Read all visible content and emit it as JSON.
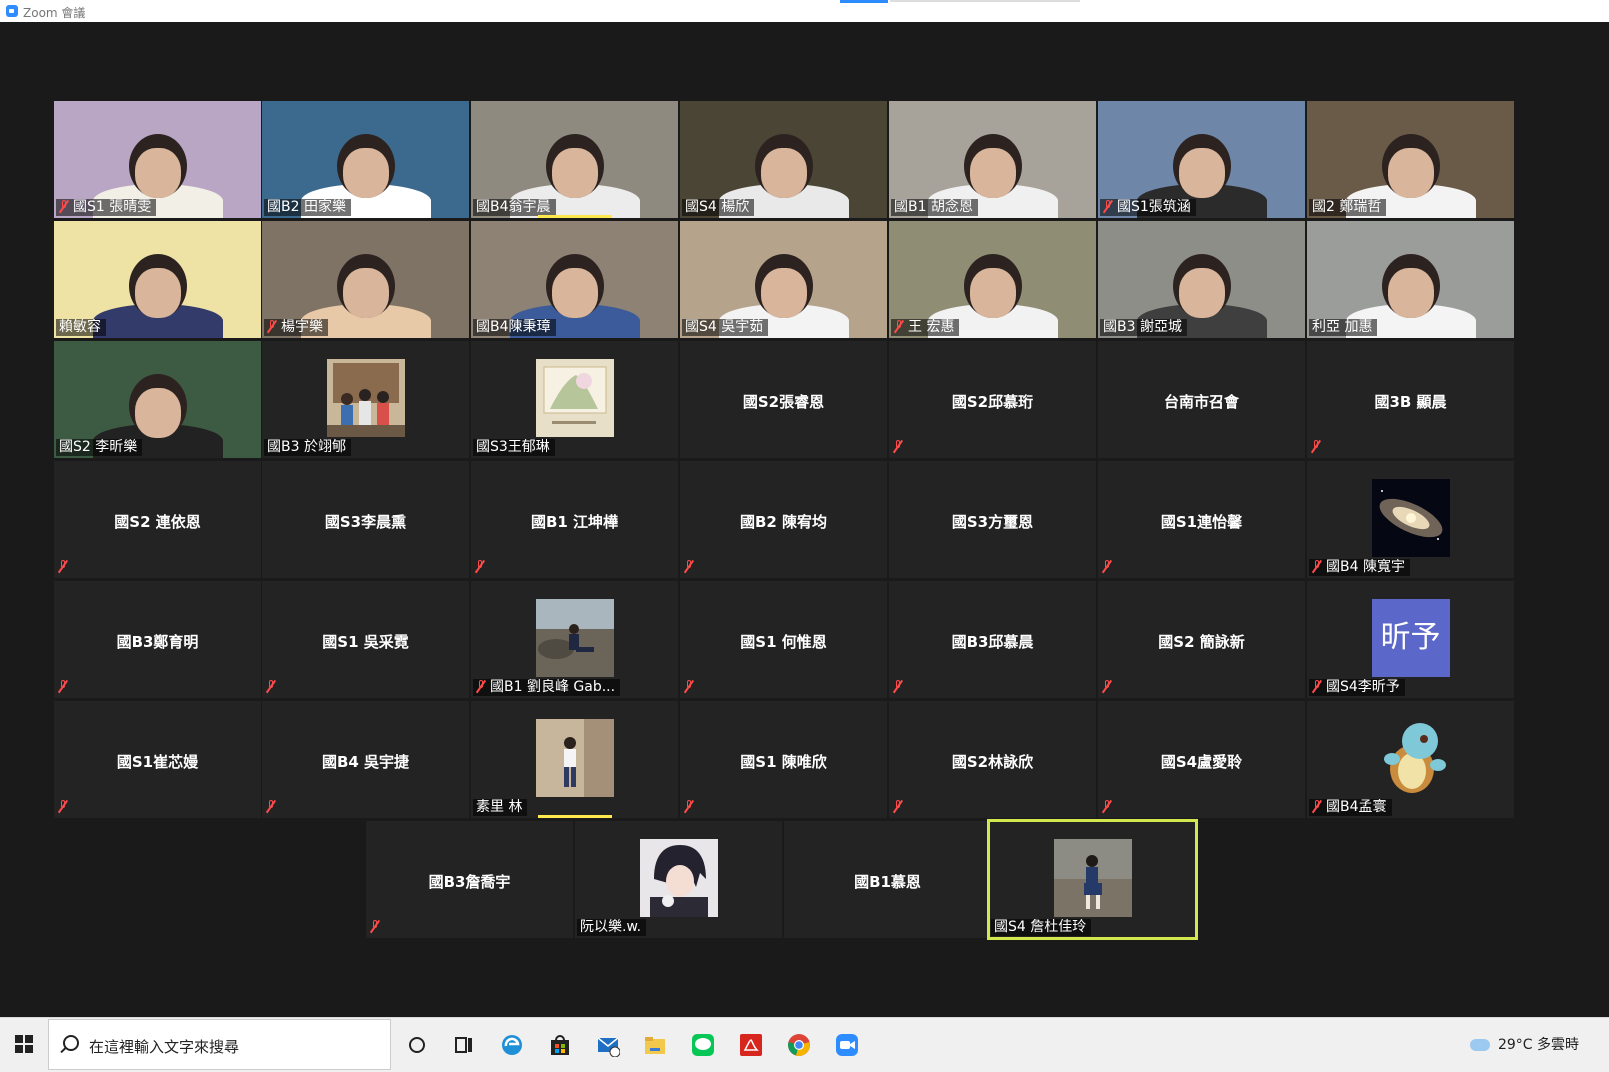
{
  "window": {
    "title": "Zoom 會議"
  },
  "video_tiles": [
    {
      "name": "國S1 張晴雯",
      "muted": true,
      "bg": "#b9a6c4",
      "shirt": "#f2efe6"
    },
    {
      "name": "國B2 田家樂",
      "muted": false,
      "bg": "#3c6a8e",
      "shirt": "#ffffff"
    },
    {
      "name": "國B4翁宇晨",
      "muted": false,
      "bg": "#8f8a7f",
      "shirt": "#ececec"
    },
    {
      "name": "國S4 楊欣",
      "muted": false,
      "bg": "#4a4534",
      "shirt": "#e9e9e9"
    },
    {
      "name": "國B1 胡念恩",
      "muted": false,
      "bg": "#a7a39a",
      "shirt": "#f0f0f0"
    },
    {
      "name": "國S1張筑涵",
      "muted": true,
      "bg": "#6e86a8",
      "shirt": "#2b2b2b"
    },
    {
      "name": "國2 鄭瑞哲",
      "muted": false,
      "bg": "#6a5a48",
      "shirt": "#f3f3f3"
    },
    {
      "name": "賴敏容",
      "muted": false,
      "bg": "#efe2a5",
      "shirt": "#333b6b"
    },
    {
      "name": "楊宇樂",
      "muted": true,
      "bg": "#7f7366",
      "shirt": "#e7c9a7"
    },
    {
      "name": "國B4陳秉璋",
      "muted": false,
      "bg": "#8d8273",
      "shirt": "#3b5b9a"
    },
    {
      "name": "國S4 吳宇茹",
      "muted": false,
      "bg": "#b6a38b",
      "shirt": "#f3f3f3"
    },
    {
      "name": "王 宏惠",
      "muted": true,
      "bg": "#8f8e75",
      "shirt": "#f2f2f2"
    },
    {
      "name": "國B3 謝亞城",
      "muted": false,
      "bg": "#8d8e88",
      "shirt": "#3f3f3f"
    },
    {
      "name": "利亞 加惠",
      "muted": false,
      "bg": "#9b9d9b",
      "shirt": "#f4f4f4"
    },
    {
      "name": "國S2 李昕樂",
      "muted": false,
      "bg": "#3d5a43",
      "shirt": "#222222"
    }
  ],
  "avatar_tiles": [
    {
      "name": "國B3 於翊郇",
      "muted": false,
      "art": "family-photo"
    },
    {
      "name": "國S3王郁琳",
      "muted": false,
      "art": "drawing-card"
    },
    {
      "name": "國B4 陳寬宇",
      "muted": true,
      "art": "galaxy"
    },
    {
      "name": "國B1 劉良峰 Gab...",
      "muted": true,
      "art": "beach-photo"
    },
    {
      "name": "國S4李昕予",
      "muted": true,
      "art": "initials",
      "initials": "昕予"
    },
    {
      "name": "素里 林",
      "muted": false,
      "art": "person-photo"
    },
    {
      "name": "國B4孟寰",
      "muted": true,
      "art": "squirtle"
    },
    {
      "name": "阮以樂.w.",
      "muted": false,
      "art": "anime-boy"
    },
    {
      "name": "國S4 詹杜佳玲",
      "muted": false,
      "art": "sitting-photo"
    }
  ],
  "name_tiles": [
    {
      "name": "國S2張睿恩",
      "muted": false
    },
    {
      "name": "國S2邱慕珩",
      "muted": true
    },
    {
      "name": "台南市召會",
      "muted": false
    },
    {
      "name": "國3B 顯晨",
      "muted": true
    },
    {
      "name": "國S2 連依恩",
      "muted": true
    },
    {
      "name": "國S3李晨熏",
      "muted": false
    },
    {
      "name": "國B1 江坤樺",
      "muted": true
    },
    {
      "name": "國B2 陳宥均",
      "muted": true
    },
    {
      "name": "國S3方璽恩",
      "muted": false
    },
    {
      "name": "國S1連怡馨",
      "muted": true
    },
    {
      "name": "國B3鄭育明",
      "muted": true
    },
    {
      "name": "國S1 吳采霓",
      "muted": true
    },
    {
      "name": "國S1 何惟恩",
      "muted": true
    },
    {
      "name": "國B3邱慕晨",
      "muted": true
    },
    {
      "name": "國S2 簡詠新",
      "muted": true
    },
    {
      "name": "國S1崔芯嫚",
      "muted": true
    },
    {
      "name": "國B4 吳宇捷",
      "muted": true
    },
    {
      "name": "國S1 陳唯欣",
      "muted": true
    },
    {
      "name": "國S2林詠欣",
      "muted": true
    },
    {
      "name": "國S4盧愛聆",
      "muted": true
    },
    {
      "name": "國B3詹喬宇",
      "muted": true
    },
    {
      "name": "國B1慕恩",
      "muted": false
    }
  ],
  "taskbar": {
    "search_placeholder": "在這裡輸入文字來搜尋",
    "weather": "29°C  多雲時",
    "icons": [
      "windows-start-icon",
      "cortana-icon",
      "task-view-icon",
      "edge-icon",
      "store-icon",
      "mail-icon",
      "file-explorer-icon",
      "line-icon",
      "acrobat-icon",
      "chrome-icon",
      "zoom-icon"
    ]
  },
  "colors": {
    "speaking_border": "#d3e84f",
    "mute_red": "#ff4a4a",
    "zoom_blue": "#2d8cff",
    "initials_bg": "#5b68c9"
  }
}
